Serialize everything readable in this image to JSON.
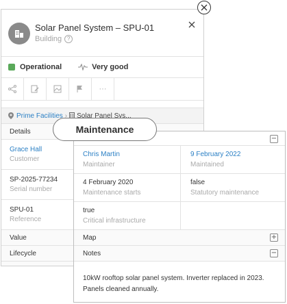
{
  "header": {
    "title": "Solar Panel System – SPU-01",
    "type": "Building",
    "help": "?"
  },
  "status": {
    "operational_label": "Operational",
    "operational_color": "#5aa95a",
    "health_label": "Very good"
  },
  "toolbar": {
    "icons": [
      "share-icon",
      "edit-icon",
      "map-icon",
      "flag-icon",
      "more-icon"
    ],
    "more": "···"
  },
  "breadcrumb": {
    "root": "Prime Facilities",
    "current": "Solar Panel Sys..."
  },
  "details": {
    "section_label": "Details",
    "fields": [
      {
        "value": "Grace Hall",
        "label": "Customer"
      },
      {
        "value": "SP-2025-77234",
        "label": "Serial number"
      },
      {
        "value": "SPU-01",
        "label": "Reference"
      }
    ],
    "value_label": "Value",
    "lifecycle_label": "Lifecycle",
    "maintenance_label": "Maintenance"
  },
  "popover": {
    "title": "Maintenance",
    "fields": [
      {
        "value": "Chris Martin",
        "label": "Maintainer"
      },
      {
        "value": "9 February 2022",
        "label": "Maintained"
      },
      {
        "value": "4 February 2020",
        "label": "Maintenance starts"
      },
      {
        "value": "false",
        "label": "Statutory maintenance"
      },
      {
        "value": "true",
        "label": "Critical infrastructure"
      }
    ],
    "map_label": "Map",
    "notes_label": "Notes",
    "notes_text": "10kW rooftop solar panel system. Inverter replaced in 2023. Panels cleaned annually.",
    "expand_symbol": "+",
    "collapse_symbol": "−"
  }
}
